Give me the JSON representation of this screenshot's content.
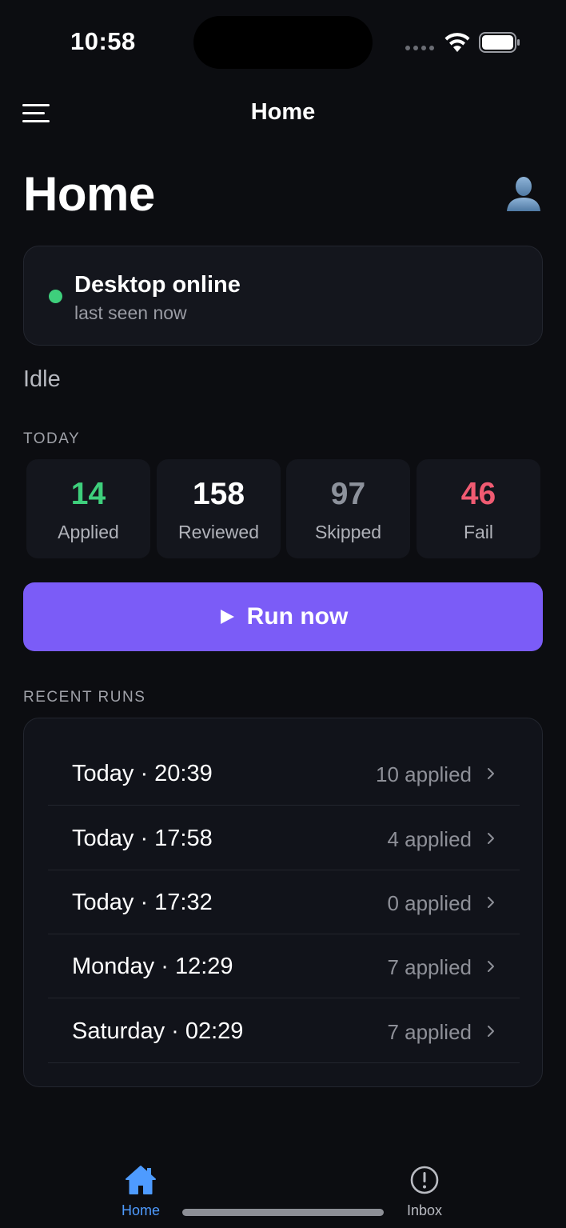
{
  "status_bar": {
    "time": "10:58"
  },
  "nav": {
    "title": "Home"
  },
  "page": {
    "title": "Home"
  },
  "desktop": {
    "title": "Desktop online",
    "subtitle": "last seen now",
    "status_color": "#3ecf7c"
  },
  "state_text": "Idle",
  "today": {
    "label": "TODAY",
    "stats": [
      {
        "value": "14",
        "label": "Applied",
        "color": "#3ecf7c"
      },
      {
        "value": "158",
        "label": "Reviewed",
        "color": "#ffffff"
      },
      {
        "value": "97",
        "label": "Skipped",
        "color": "#8d929c"
      },
      {
        "value": "46",
        "label": "Fail",
        "color": "#f05b72"
      }
    ]
  },
  "run_button": {
    "label": "Run now",
    "icon": "play-icon",
    "color": "#7b5cf7"
  },
  "recent_runs": {
    "label": "RECENT RUNS",
    "items": [
      {
        "time": "Today · 20:39",
        "count": "10 applied"
      },
      {
        "time": "Today · 17:58",
        "count": "4 applied"
      },
      {
        "time": "Today · 17:32",
        "count": "0 applied"
      },
      {
        "time": "Monday · 12:29",
        "count": "7 applied"
      },
      {
        "time": "Saturday · 02:29",
        "count": "7 applied"
      }
    ]
  },
  "tab_bar": {
    "tabs": [
      {
        "label": "Home",
        "icon": "home-icon",
        "active": true,
        "color": "#4e9bff"
      },
      {
        "label": "Inbox",
        "icon": "alert-circle-icon",
        "active": false,
        "color": "#b9bbc2"
      }
    ]
  }
}
